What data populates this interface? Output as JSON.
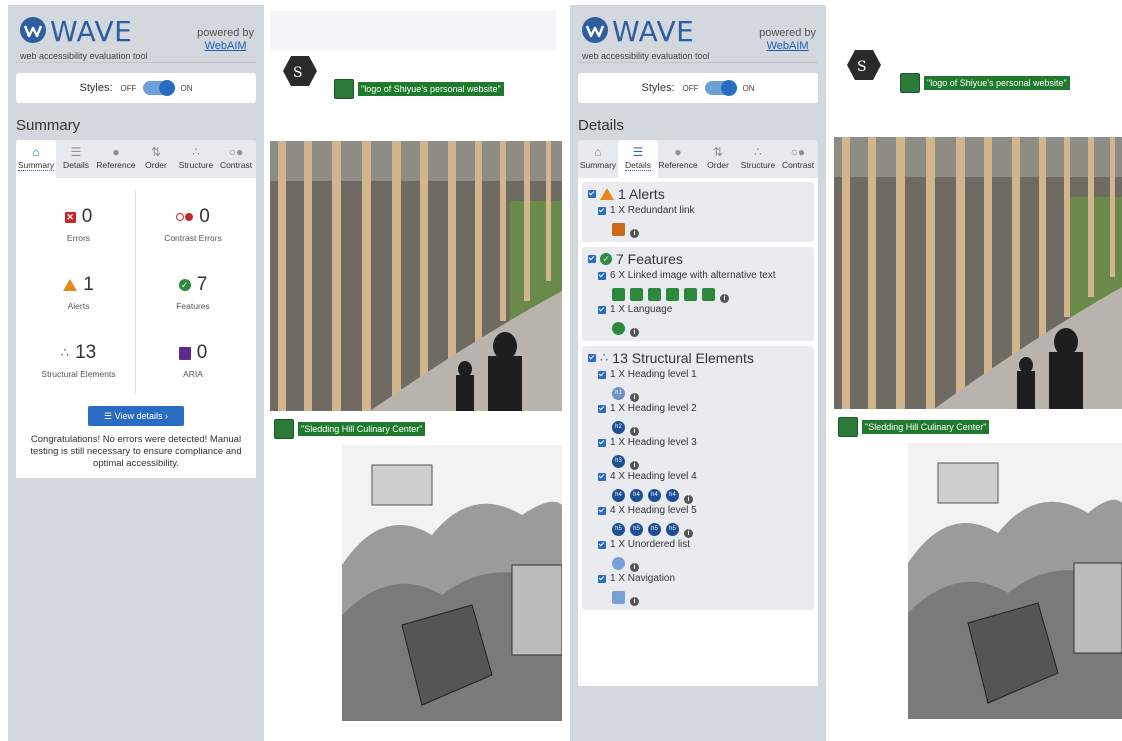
{
  "wave": {
    "logo_text": "WAVE",
    "logo_sub": "web accessibility evaluation tool",
    "powered_by": "powered by",
    "powered_link": "WebAIM",
    "styles_label": "Styles:",
    "styles_off": "OFF",
    "styles_on": "ON"
  },
  "tabs": [
    "Summary",
    "Details",
    "Reference",
    "Order",
    "Structure",
    "Contrast"
  ],
  "summary": {
    "title": "Summary",
    "errors": {
      "count": "0",
      "label": "Errors"
    },
    "contrast_errors": {
      "count": "0",
      "label": "Contrast Errors"
    },
    "alerts": {
      "count": "1",
      "label": "Alerts"
    },
    "features": {
      "count": "7",
      "label": "Features"
    },
    "structural": {
      "count": "13",
      "label": "Structural Elements"
    },
    "aria": {
      "count": "0",
      "label": "ARIA"
    },
    "view_details": "View details ›",
    "congrats": "Congratulations! No errors were detected! Manual testing is still necessary to ensure compliance and optimal accessibility."
  },
  "details": {
    "title": "Details",
    "alerts_head": "1 Alerts",
    "alert_items": [
      "1 X Redundant link"
    ],
    "features_head": "7 Features",
    "feature_items": [
      "6 X Linked image with alternative text",
      "1 X Language"
    ],
    "structural_head": "13 Structural Elements",
    "structural_items": [
      "1 X Heading level 1",
      "1 X Heading level 2",
      "1 X Heading level 3",
      "4 X Heading level 4",
      "4 X Heading level 5",
      "1 X Unordered list",
      "1 X Navigation"
    ],
    "heading_badges": [
      "h1",
      "h2",
      "h3",
      "h4",
      "h5"
    ]
  },
  "preview": {
    "logo_alt": "\"logo of Shiyue's personal website\"",
    "center_alt": "\"Sledding Hill Culinary Center\""
  },
  "colors": {
    "sidebar_bg": "#d3d8de",
    "accent": "#2a6cc2",
    "error": "#c8262c",
    "alert": "#e8891a",
    "feature": "#2b8a3e",
    "aria": "#5b2a8f"
  }
}
